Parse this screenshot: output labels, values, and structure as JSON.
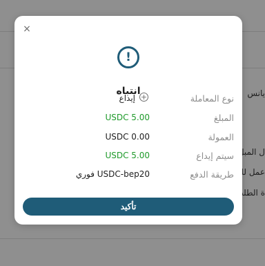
{
  "background": {
    "text_lines": [
      "يانس",
      "ل المبل",
      "عمل للة",
      "ة الطلب"
    ]
  },
  "modal": {
    "close_glyph": "×",
    "icon_glyph": "!",
    "title": "انتباه",
    "rows": [
      {
        "label": "نوع المعاملة",
        "value": "إيداع",
        "icon": "plus-circle-icon",
        "color": "#1e1e1e"
      },
      {
        "label": "المبلغ",
        "value": "USDC 5.00",
        "color": "#1e9a2a"
      },
      {
        "label": "العمولة",
        "value": "USDC 0.00",
        "color": "#1e1e1e"
      },
      {
        "label": "سيتم إيداع",
        "value": "USDC 5.00",
        "color": "#1e9a2a"
      },
      {
        "label": "طريقة الدفع",
        "value": "USDC-bep20 فوري",
        "color": "#1e1e1e"
      }
    ],
    "confirm_label": "تأكيد"
  },
  "colors": {
    "accent": "#1f5c78",
    "positive": "#1e9a2a",
    "label_gray": "#8d8d8d"
  }
}
